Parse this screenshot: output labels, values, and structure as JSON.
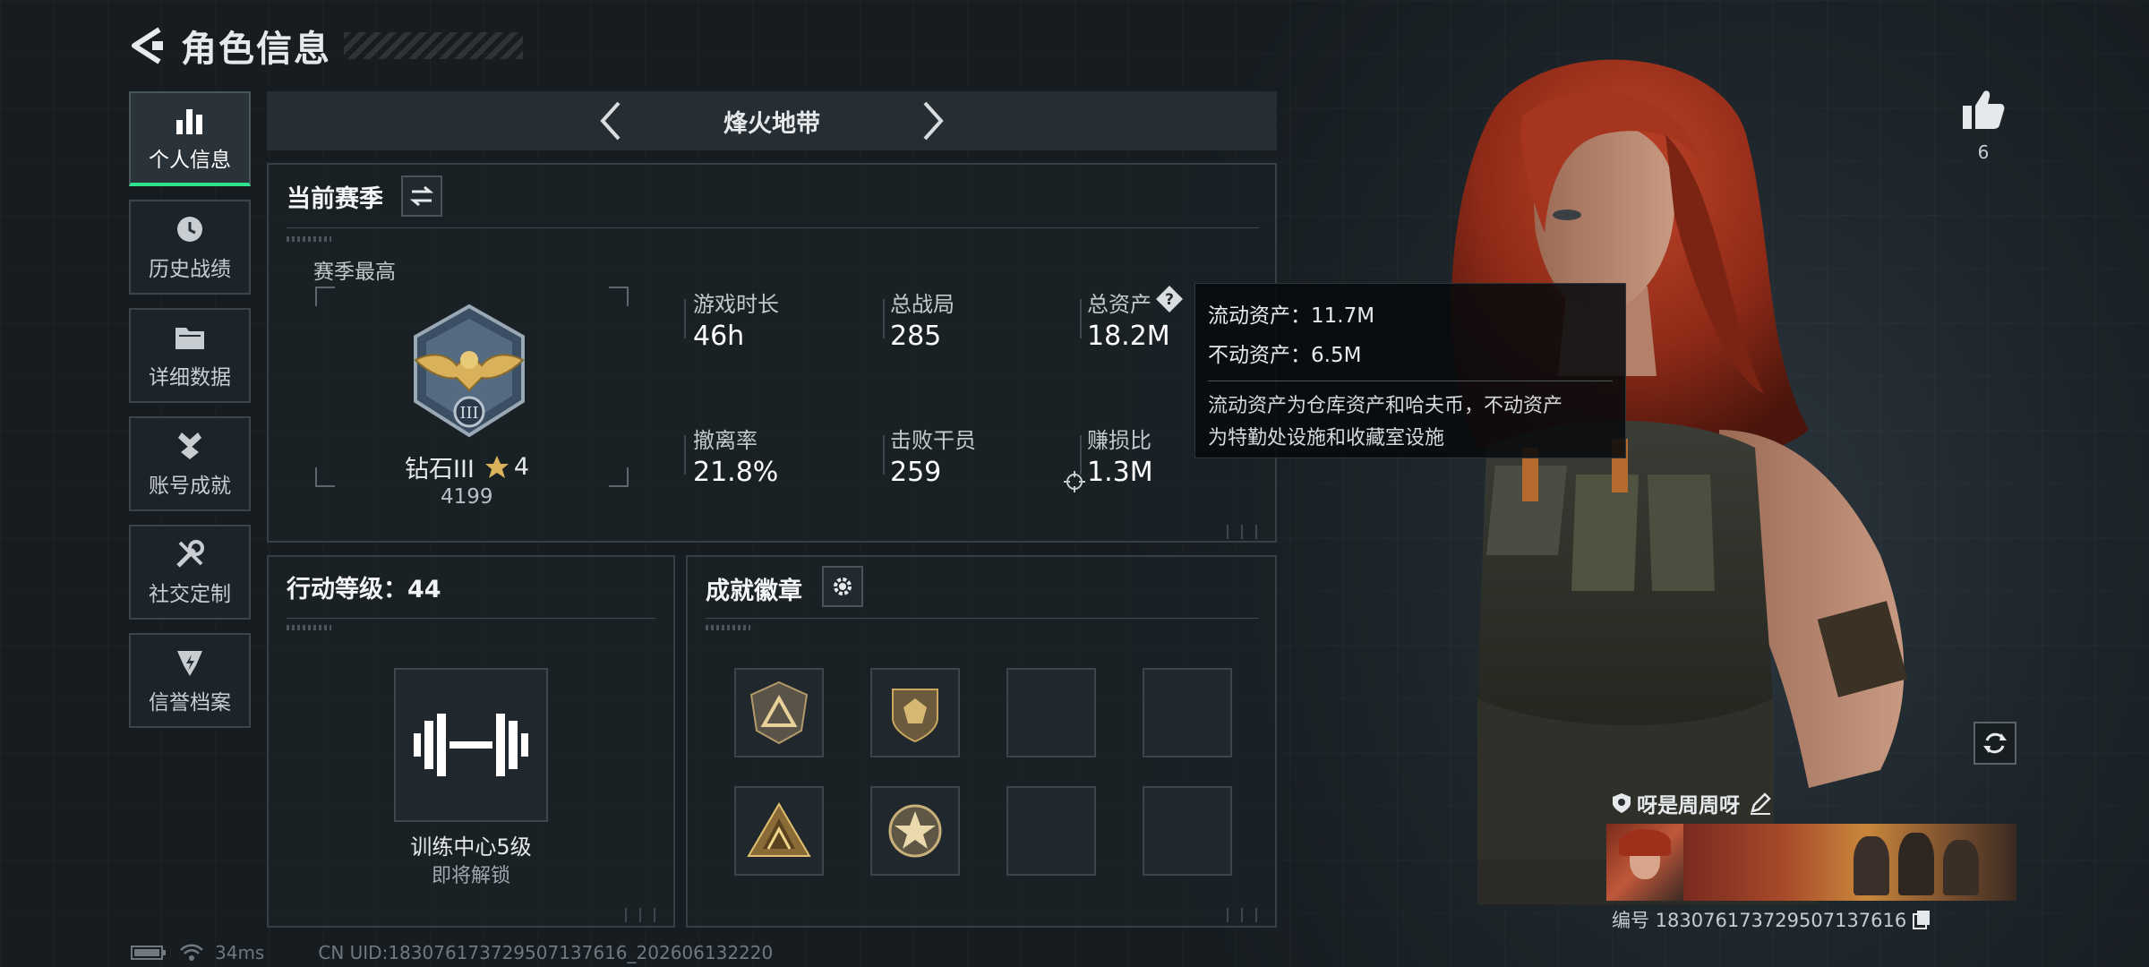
{
  "header": {
    "title": "角色信息"
  },
  "sidebar": {
    "items": [
      {
        "label": "个人信息",
        "icon": "bar-chart-icon",
        "active": true
      },
      {
        "label": "历史战绩",
        "icon": "clock-icon",
        "active": false
      },
      {
        "label": "详细数据",
        "icon": "folder-icon",
        "active": false
      },
      {
        "label": "账号成就",
        "icon": "medal-icon",
        "active": false
      },
      {
        "label": "社交定制",
        "icon": "tools-icon",
        "active": false
      },
      {
        "label": "信誉档案",
        "icon": "shield-bolt-icon",
        "active": false
      }
    ]
  },
  "mode_selector": {
    "label": "烽火地带"
  },
  "season": {
    "title": "当前赛季",
    "best_label": "赛季最高",
    "rank_name": "钻石III",
    "rank_stars": "4",
    "rank_score": "4199",
    "rank_medal_numeral": "III",
    "stats": [
      {
        "label": "游戏时长",
        "value": "46h"
      },
      {
        "label": "总战局",
        "value": "285"
      },
      {
        "label": "总资产",
        "value": "18.2M"
      },
      {
        "label": "撤离率",
        "value": "21.8%"
      },
      {
        "label": "击败干员",
        "value": "259"
      },
      {
        "label": "赚损比",
        "value": "1.3M"
      }
    ]
  },
  "tooltip": {
    "liquid": "流动资产：11.7M",
    "fixed": "不动资产：6.5M",
    "desc_line1": "流动资产为仓库资产和哈夫币，不动资产",
    "desc_line2": "为特勤处设施和收藏室设施"
  },
  "action_level": {
    "title": "行动等级：44",
    "unlock_name": "训练中心5级",
    "unlock_status": "即将解锁"
  },
  "badges": {
    "title": "成就徽章",
    "slots": [
      "triangle-badge-icon",
      "crest-badge-icon",
      "",
      "",
      "pyramid-badge-icon",
      "star-badge-icon",
      "",
      ""
    ]
  },
  "profile": {
    "likes": "6",
    "player_name": "呀是周周呀",
    "player_id": "编号 183076173729507137616"
  },
  "footer": {
    "ping": "34ms",
    "uid": "CN UID:183076173729507137616_202606132220"
  },
  "colors": {
    "accent": "#2fe38c",
    "panel_border": "#364147",
    "gold": "#d8b15a"
  }
}
